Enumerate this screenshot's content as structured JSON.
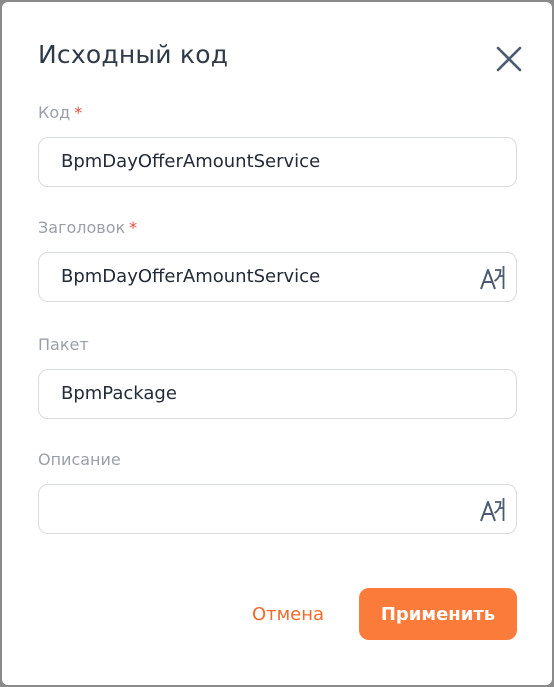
{
  "dialog": {
    "title": "Исходный код",
    "close_icon": "close-icon"
  },
  "fields": {
    "code": {
      "label": "Код",
      "required_mark": "*",
      "value": "BpmDayOfferAmountService"
    },
    "caption": {
      "label": "Заголовок",
      "required_mark": "*",
      "value": "BpmDayOfferAmountService",
      "icon": "translate-icon"
    },
    "package": {
      "label": "Пакет",
      "value": "BpmPackage"
    },
    "description": {
      "label": "Описание",
      "value": "",
      "icon": "translate-icon"
    }
  },
  "buttons": {
    "cancel_label": "Отмена",
    "apply_label": "Применить"
  },
  "colors": {
    "accent": "#fa7b3a",
    "accent_text": "#f26a2b",
    "required": "#e04b3c"
  }
}
